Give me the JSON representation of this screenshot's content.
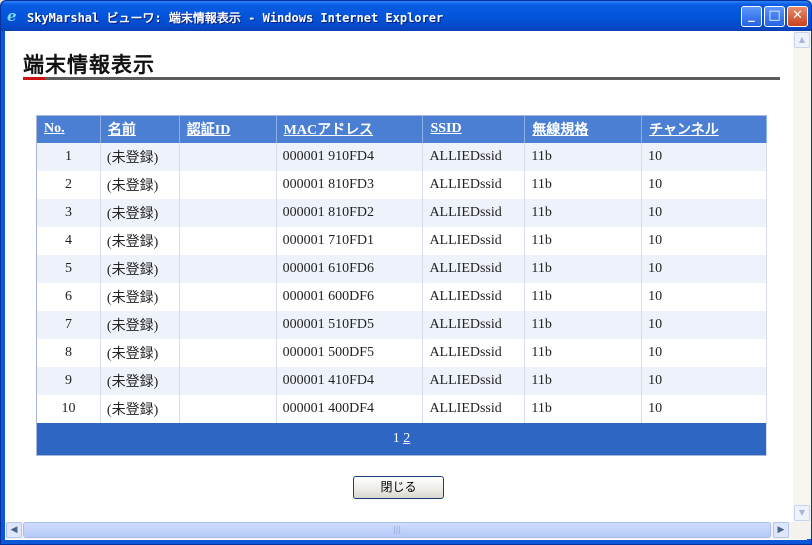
{
  "window": {
    "title": "SkyMarshal ビューワ: 端末情報表示 - Windows Internet Explorer",
    "minimize": "_",
    "maximize": "□",
    "close": "✕"
  },
  "page": {
    "heading": "端末情報表示",
    "close_button": "閉じる"
  },
  "table": {
    "headers": [
      "No.",
      "名前",
      "認証ID",
      "MACアドレス",
      "SSID",
      "無線規格",
      "チャンネル"
    ],
    "rows": [
      [
        "1",
        "(未登録)",
        "",
        "000001 910FD4",
        "ALLIEDssid",
        "11b",
        "10"
      ],
      [
        "2",
        "(未登録)",
        "",
        "000001 810FD3",
        "ALLIEDssid",
        "11b",
        "10"
      ],
      [
        "3",
        "(未登録)",
        "",
        "000001 810FD2",
        "ALLIEDssid",
        "11b",
        "10"
      ],
      [
        "4",
        "(未登録)",
        "",
        "000001 710FD1",
        "ALLIEDssid",
        "11b",
        "10"
      ],
      [
        "5",
        "(未登録)",
        "",
        "000001 610FD6",
        "ALLIEDssid",
        "11b",
        "10"
      ],
      [
        "6",
        "(未登録)",
        "",
        "000001 600DF6",
        "ALLIEDssid",
        "11b",
        "10"
      ],
      [
        "7",
        "(未登録)",
        "",
        "000001 510FD5",
        "ALLIEDssid",
        "11b",
        "10"
      ],
      [
        "8",
        "(未登録)",
        "",
        "000001 500DF5",
        "ALLIEDssid",
        "11b",
        "10"
      ],
      [
        "9",
        "(未登録)",
        "",
        "000001 410FD4",
        "ALLIEDssid",
        "11b",
        "10"
      ],
      [
        "10",
        "(未登録)",
        "",
        "000001 400DF4",
        "ALLIEDssid",
        "11b",
        "10"
      ]
    ],
    "pager": {
      "current": "1",
      "next": "2"
    }
  },
  "icons": {
    "browser": "ie-logo-icon",
    "scroll_up": "arrow-up-icon",
    "scroll_down": "arrow-down-icon",
    "scroll_left": "arrow-left-icon",
    "scroll_right": "arrow-right-icon"
  },
  "colors": {
    "title_bar": "#0355db",
    "table_header": "#4a7fd3",
    "pager_bar": "#2e66c4",
    "accent_red": "#cc1111"
  }
}
